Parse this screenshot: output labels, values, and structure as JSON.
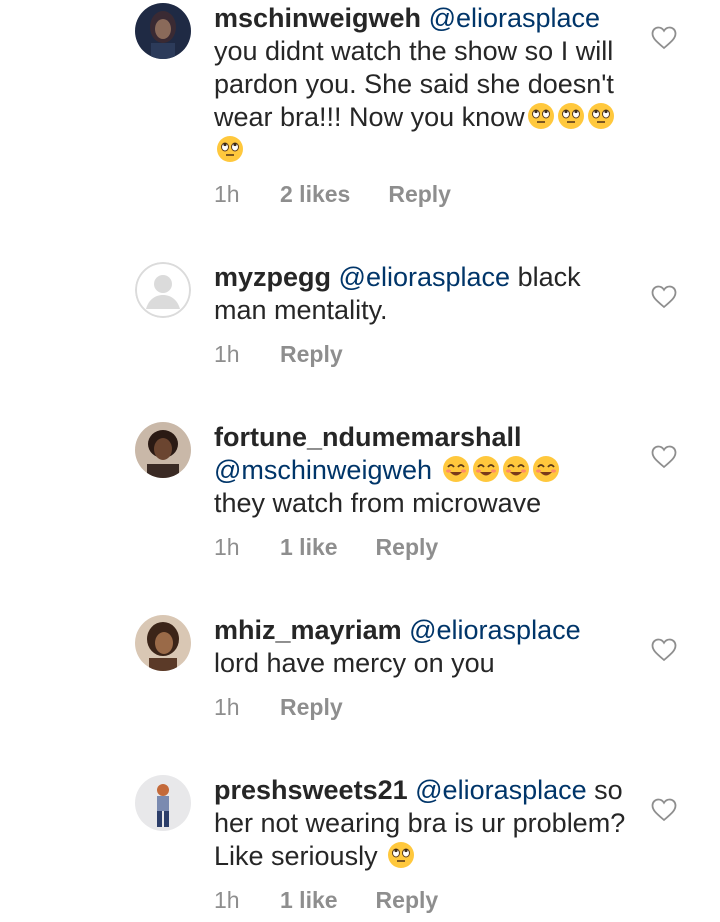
{
  "comments": [
    {
      "username": "mschinweigweh",
      "mention": "@eliorasplace",
      "text": "you didnt watch the show so I will pardon you. She said she doesn't wear bra!!! Now you know",
      "emojis": [
        "eye-roll",
        "eye-roll",
        "eye-roll",
        "eye-roll"
      ],
      "time": "1h",
      "likes": "2 likes",
      "reply": "Reply"
    },
    {
      "username": "myzpegg",
      "mention": "@eliorasplace",
      "text": "black man mentality.",
      "emojis": [],
      "time": "1h",
      "likes": "",
      "reply": "Reply"
    },
    {
      "username": "fortune_ndumemarshall",
      "mention": "@mschinweigweh",
      "text": "they watch from microwave",
      "emojis": [
        "smiling-eyes",
        "smiling-eyes",
        "smiling-eyes",
        "smiling-eyes"
      ],
      "time": "1h",
      "likes": "1 like",
      "reply": "Reply"
    },
    {
      "username": "mhiz_mayriam",
      "mention": "@eliorasplace",
      "text": "lord have mercy on you",
      "emojis": [],
      "time": "1h",
      "likes": "",
      "reply": "Reply"
    },
    {
      "username": "preshsweets21",
      "mention": "@eliorasplace",
      "text": "so her not wearing bra is ur problem? Like seriously",
      "emojis": [
        "eye-roll"
      ],
      "time": "1h",
      "likes": "1 like",
      "reply": "Reply"
    }
  ],
  "colors": {
    "text": "#262626",
    "mention": "#003569",
    "meta": "#8e8e8e",
    "emoji": "#ffc83d"
  },
  "icons": {
    "like": "heart-outline-icon"
  }
}
